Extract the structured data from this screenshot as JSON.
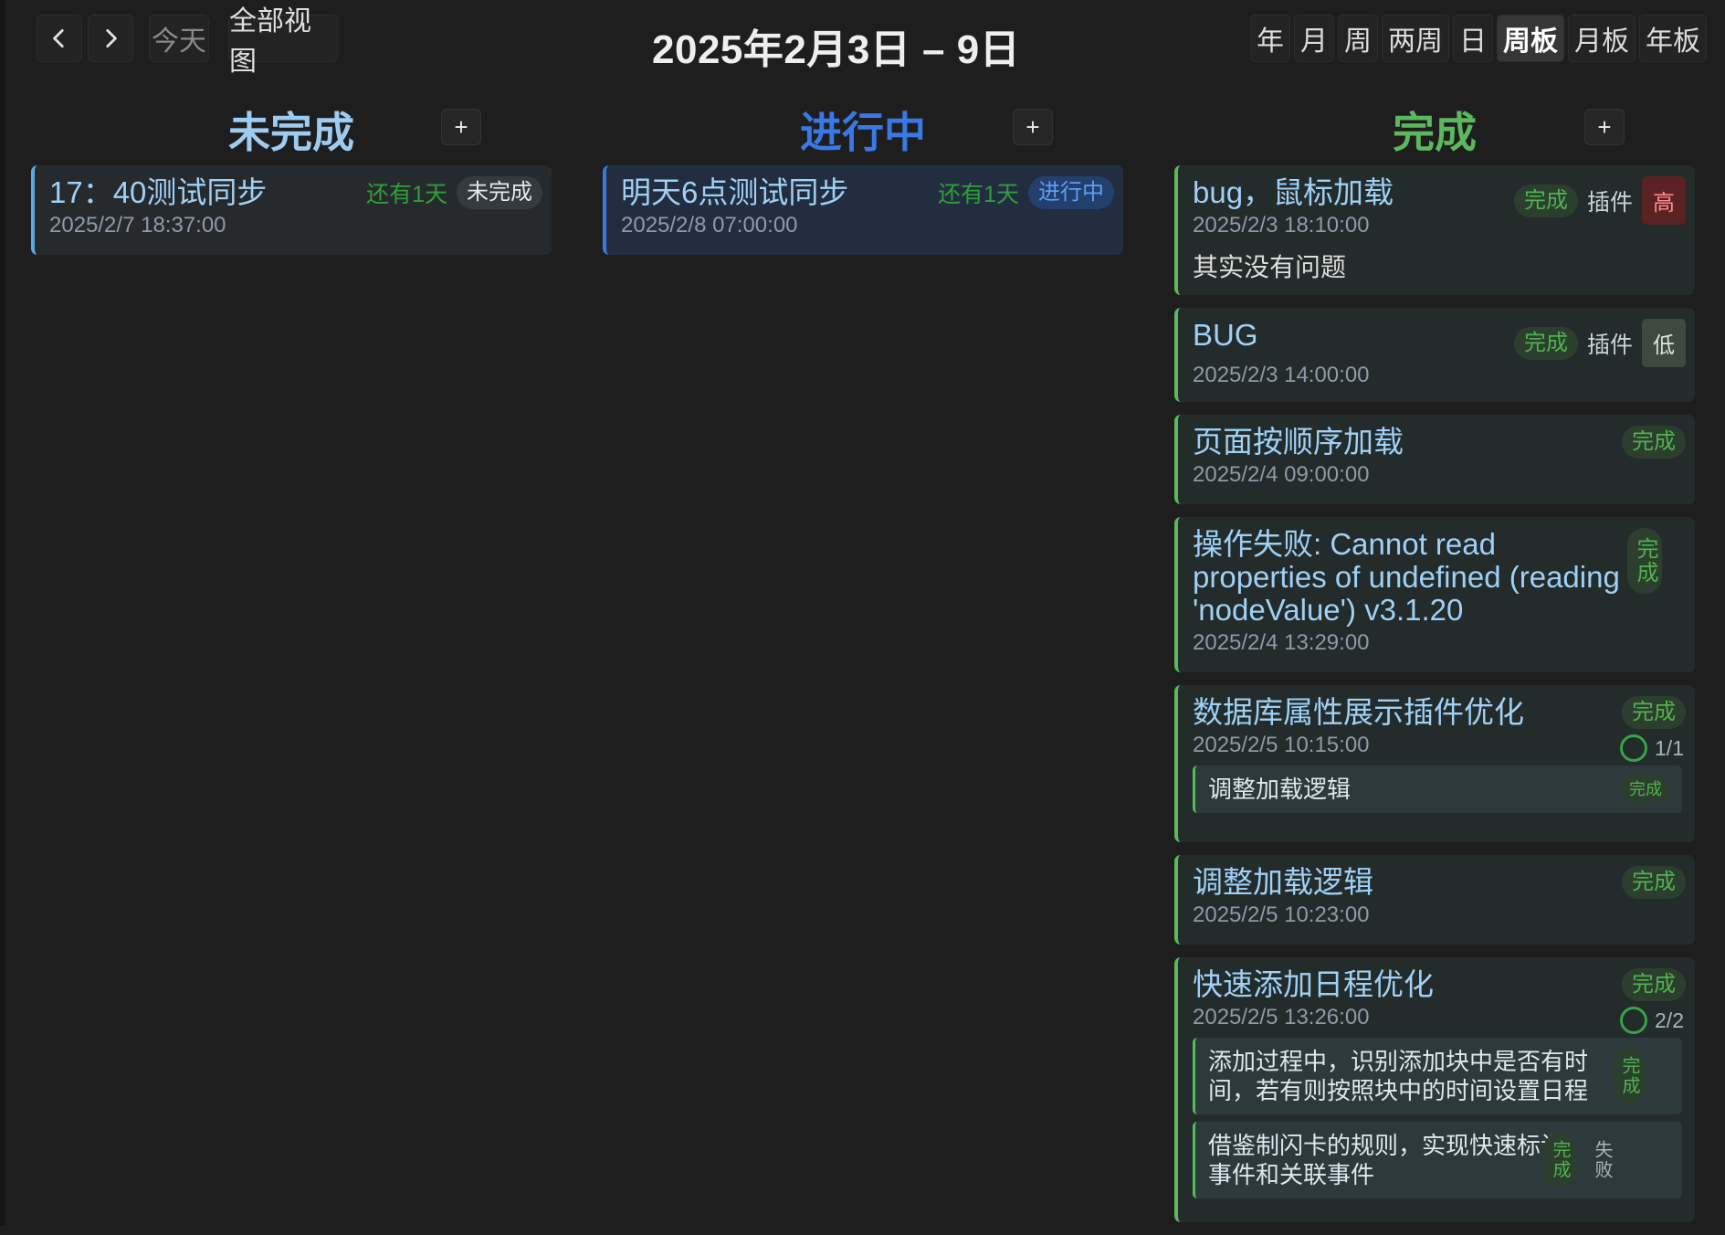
{
  "toolbar": {
    "prev_icon": "chevron-left-icon",
    "next_icon": "chevron-right-icon",
    "today": "今天",
    "all_views": "全部视图",
    "title": "2025年2月3日 – 9日",
    "views": [
      "年",
      "月",
      "周",
      "两周",
      "日",
      "周板",
      "月板",
      "年板"
    ],
    "active_view": "周板"
  },
  "columns": {
    "todo": {
      "title": "未完成",
      "color": "#9ecbf0",
      "add": "+",
      "cards": [
        {
          "title": "17：40测试同步",
          "date": "2025/2/7 18:37:00",
          "remain": "还有1天",
          "status": "未完成"
        }
      ]
    },
    "doing": {
      "title": "进行中",
      "color": "#3a78e6",
      "add": "+",
      "cards": [
        {
          "title": "明天6点测试同步",
          "date": "2025/2/8 07:00:00",
          "remain": "还有1天",
          "status": "进行中"
        }
      ]
    },
    "done": {
      "title": "完成",
      "color": "#5cb85c",
      "add": "+",
      "cards": [
        {
          "title": "bug，鼠标加载",
          "date": "2025/2/3 18:10:00",
          "status": "完成",
          "tag": "插件",
          "priority": "高",
          "note": "其实没有问题"
        },
        {
          "title": "BUG",
          "date": "2025/2/3 14:00:00",
          "status": "完成",
          "tag": "插件",
          "priority": "低"
        },
        {
          "title": "页面按顺序加载",
          "date": "2025/2/4 09:00:00",
          "status": "完成"
        },
        {
          "title": "操作失败: Cannot read properties of undefined (reading 'nodeValue') v3.1.20",
          "date": "2025/2/4 13:29:00",
          "status": "完成"
        },
        {
          "title": "数据库属性展示插件优化",
          "date": "2025/2/5 10:15:00",
          "status": "完成",
          "progress": "1/1",
          "subtasks": [
            {
              "title": "调整加载逻辑",
              "status": "完成"
            }
          ]
        },
        {
          "title": "调整加载逻辑",
          "date": "2025/2/5 10:23:00",
          "status": "完成"
        },
        {
          "title": "快速添加日程优化",
          "date": "2025/2/5 13:26:00",
          "status": "完成",
          "progress": "2/2",
          "subtasks": [
            {
              "title": "添加过程中，识别添加块中是否有时间，若有则按照块中的时间设置日程",
              "status": "完成"
            },
            {
              "title": "借鉴制闪卡的规则，实现快速标记事件和关联事件",
              "status": "完成",
              "extra": "失败"
            }
          ]
        }
      ]
    }
  }
}
